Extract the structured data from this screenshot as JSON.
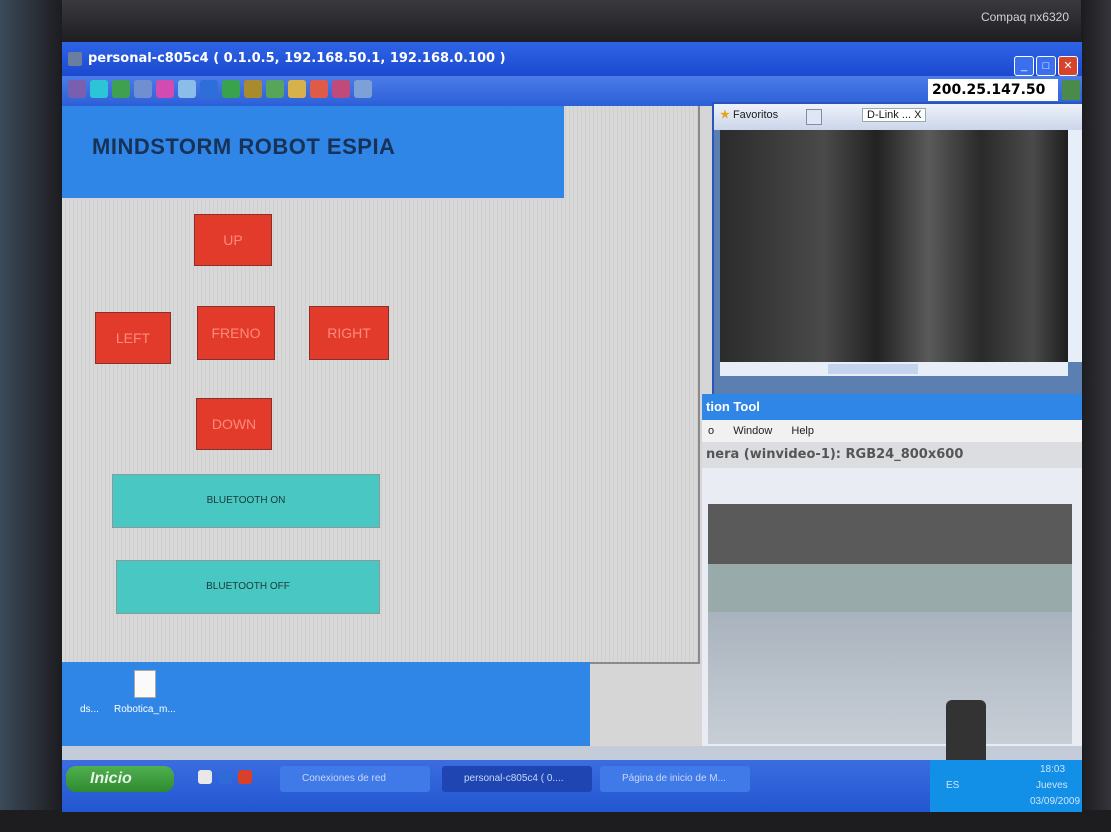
{
  "device": {
    "brand": "Compaq nx6320"
  },
  "window": {
    "title": "personal-c805c4 ( 0.1.0.5, 192.168.50.1, 192.168.0.100 )",
    "address": "200.25.147.50"
  },
  "app": {
    "title": "MINDSTORM ROBOT ESPIA",
    "buttons": {
      "up": "UP",
      "left": "LEFT",
      "freno": "FRENO",
      "right": "RIGHT",
      "down": "DOWN",
      "bt_on": "BLUETOOTH  ON",
      "bt_off": "BLUETOOTH  OFF"
    }
  },
  "browser": {
    "favorites": "Favoritos",
    "tab_label": "D-Link ...",
    "tab_close": "X"
  },
  "capture": {
    "title": "tion Tool",
    "menu": [
      "Window",
      "Help"
    ],
    "menu_lead": "o",
    "info": "nera (winvideo-1): RGB24_800x600"
  },
  "desktop": {
    "lead_label": "ds...",
    "file_label": "Robotica_m..."
  },
  "taskbar": {
    "start": "Inicio",
    "items": [
      "Conexiones de red",
      "personal-c805c4 ( 0....",
      "Página de inicio de M..."
    ],
    "lang": "ES",
    "time": "18:03",
    "day": "Jueves",
    "date": "03/09/2009"
  },
  "colors": {
    "banner": "#2f86e6",
    "control_button": "#e23b2b",
    "bluetooth_button": "#49c7c2",
    "titlebar": "#1b49cf"
  }
}
